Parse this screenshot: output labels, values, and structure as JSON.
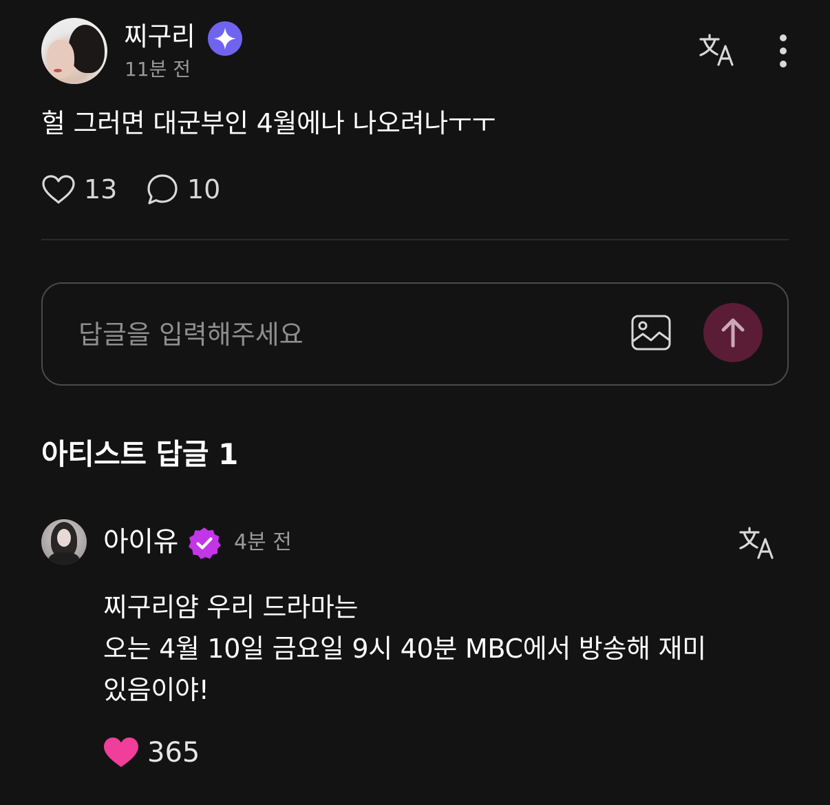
{
  "post": {
    "author": "찌구리",
    "time": "11분 전",
    "body": "헐 그러면 대군부인 4월에나 나오려나ㅜㅜ",
    "likes": "13",
    "comments": "10"
  },
  "reply_input": {
    "placeholder": "답글을 입력해주세요"
  },
  "section": {
    "title": "아티스트 답글 1"
  },
  "artist_reply": {
    "author": "아이유",
    "time": "4분 전",
    "lines": [
      "찌구리얌 우리 드라마는",
      "오는 4월 10일 금요일 9시 40분 MBC에서 방송해 재미",
      "있음이야!"
    ],
    "likes": "365"
  },
  "colors": {
    "background": "#131313",
    "official_badge": "#6f63f0",
    "artist_badge": "#c236e8",
    "liked_heart": "#f03e9a",
    "send_button": "#5a1d35"
  },
  "icons": {
    "official_badge": "sparkle-badge-icon",
    "translate": "translate-icon",
    "more": "more-vertical-icon",
    "like": "heart-icon",
    "comment": "comment-bubble-icon",
    "image": "image-icon",
    "send": "arrow-up-icon",
    "artist_badge": "verified-check-icon"
  }
}
